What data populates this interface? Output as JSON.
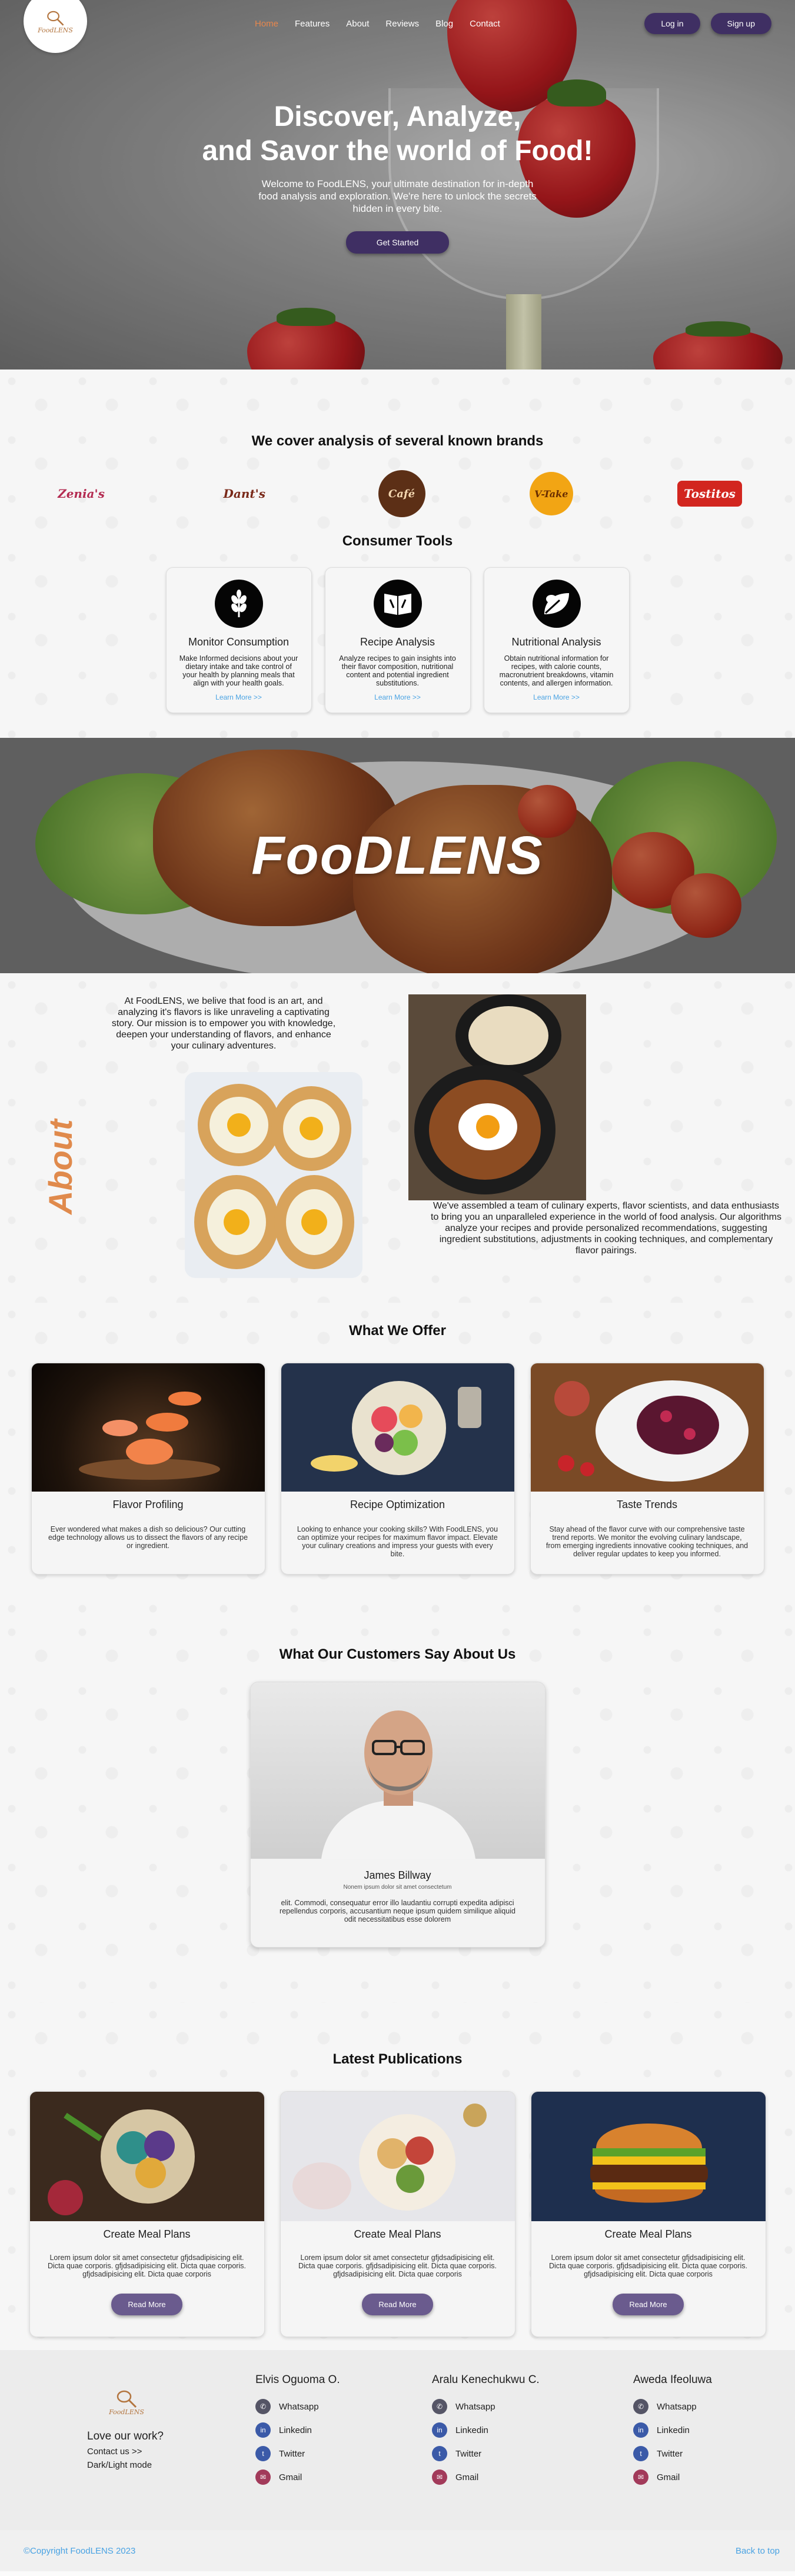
{
  "nav": {
    "logo_text": "FoodLENS",
    "links": [
      "Home",
      "Features",
      "About",
      "Reviews",
      "Blog",
      "Contact"
    ],
    "login": "Log in",
    "signup": "Sign up"
  },
  "hero": {
    "title_line1": "Discover, Analyze,",
    "title_line2": "and Savor the world of Food!",
    "subtitle": "Welcome to FoodLENS, your ultimate destination for in-depth food analysis and exploration. We're here to unlock the secrets hidden in every bite.",
    "cta": "Get Started"
  },
  "brands": {
    "title": "We cover analysis of several known brands",
    "names": [
      "Zenia's",
      "Dant's",
      "Café",
      "V-Take",
      "Tostitos"
    ]
  },
  "tools": {
    "title": "Consumer Tools",
    "items": [
      {
        "title": "Monitor Consumption",
        "desc": "Make Informed decisions about your dietary intake and take control of your health by planning meals that align with your health goals.",
        "link": "Learn More >>",
        "icon": "wheat-icon"
      },
      {
        "title": "Recipe Analysis",
        "desc": "Analyze recipes to gain insights into their flavor composition, nutritional content and potential ingredient substitutions.",
        "link": "Learn More >>",
        "icon": "recipe-book-icon"
      },
      {
        "title": "Nutritional Analysis",
        "desc": "Obtain nutritional information for recipes, with calorie counts, macronutrient breakdowns, vitamin contents, and allergen information.",
        "link": "Learn More >>",
        "icon": "leaf-icon"
      }
    ]
  },
  "banner": {
    "title": "FooDLENS"
  },
  "about": {
    "heading": "About",
    "para1": "At FoodLENS, we belive that food is an art, and analyzing it's flavors is like unraveling a captivating story. Our mission is to empower you with knowledge, deepen your understanding of flavors, and enhance your culinary adventures.",
    "para2": "We've assembled a team of culinary experts, flavor scientists, and data enthusiasts to bring you an unparalleled experience in the world of food analysis. Our algorithms analyze your recipes and provide personalized recommendations, suggesting ingredient substitutions, adjustments in cooking techniques, and complementary flavor pairings."
  },
  "offer": {
    "title": "What We Offer",
    "items": [
      {
        "title": "Flavor Profiling",
        "desc": "Ever wondered what makes a dish so delicious? Our cutting edge technology allows us to dissect the flavors of any recipe or ingredient."
      },
      {
        "title": "Recipe Optimization",
        "desc": "Looking to enhance your cooking skills? With FoodLENS, you can optimize your recipes for maximum flavor impact. Elevate your culinary creations and impress your guests with every bite."
      },
      {
        "title": "Taste Trends",
        "desc": "Stay ahead of the flavor curve with our comprehensive taste trend reports. We monitor the evolving culinary landscape, from emerging ingredients innovative cooking techniques, and deliver regular updates to keep you informed."
      }
    ]
  },
  "testimonials": {
    "title": "What Our Customers Say About Us",
    "name": "James Billway",
    "role": "Nonem ipsum dolor sit amet consectetum",
    "quote": "elit. Commodi, consequatur error illo laudantiu corrupti expedita adipisci repellendus corporis, accusantium neque ipsum quidem similique aliquid odit necessitatibus esse dolorem"
  },
  "publications": {
    "title": "Latest Publications",
    "items": [
      {
        "title": "Create Meal Plans",
        "desc": "Lorem ipsum dolor sit amet consectetur gfjdsadipisicing elit. Dicta quae corporis. gfjdsadipisicing elit. Dicta quae corporis. gfjdsadipisicing elit. Dicta quae corporis",
        "button": "Read More"
      },
      {
        "title": "Create Meal Plans",
        "desc": "Lorem ipsum dolor sit amet consectetur gfjdsadipisicing elit. Dicta quae corporis. gfjdsadipisicing elit. Dicta quae corporis. gfjdsadipisicing elit. Dicta quae corporis",
        "button": "Read More"
      },
      {
        "title": "Create Meal Plans",
        "desc": "Lorem ipsum dolor sit amet consectetur gfjdsadipisicing elit. Dicta quae corporis. gfjdsadipisicing elit. Dicta quae corporis. gfjdsadipisicing elit. Dicta quae corporis",
        "button": "Read More"
      }
    ]
  },
  "footer": {
    "logo_text": "FoodLENS",
    "love": "Love our work?",
    "contact": "Contact us >>",
    "mode": "Dark/Light mode",
    "columns": [
      {
        "name": "Elvis Oguoma O.",
        "links": [
          "Whatsapp",
          "Linkedin",
          "Twitter",
          "Gmail"
        ]
      },
      {
        "name": "Aralu Kenechukwu C.",
        "links": [
          "Whatsapp",
          "Linkedin",
          "Twitter",
          "Gmail"
        ]
      },
      {
        "name": "Aweda Ifeoluwa",
        "links": [
          "Whatsapp",
          "Linkedin",
          "Twitter",
          "Gmail"
        ]
      }
    ],
    "copyright": "©Copyright FoodLENS 2023",
    "back_to_top": "Back to top"
  },
  "colors": {
    "accent": "#3f2f63",
    "orange": "#e08a4c",
    "link": "#4aa3e3"
  }
}
